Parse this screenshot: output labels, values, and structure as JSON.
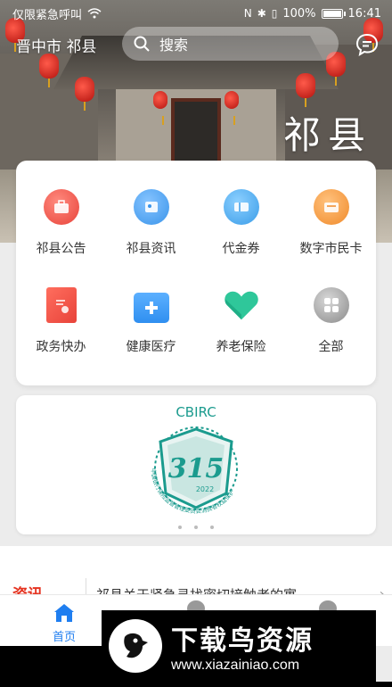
{
  "status_bar": {
    "carrier": "仅限紧急呼叫",
    "battery": "100%",
    "time": "16:41"
  },
  "header": {
    "city": "晋中市 祁县",
    "search_placeholder": "搜索",
    "calligraphy": "祁县"
  },
  "services": [
    {
      "label": "祁县公告",
      "icon": "notice-icon",
      "color": "#e8433a"
    },
    {
      "label": "祁县资讯",
      "icon": "news-icon",
      "color": "#3a94ea"
    },
    {
      "label": "代金券",
      "icon": "voucher-icon",
      "color": "#3a9ce8"
    },
    {
      "label": "数字市民卡",
      "icon": "citizen-card-icon",
      "color": "#f08a2a"
    },
    {
      "label": "政务快办",
      "icon": "government-affairs-icon",
      "color": "#e8433a"
    },
    {
      "label": "健康医疗",
      "icon": "medical-icon",
      "color": "#2f8ff0"
    },
    {
      "label": "养老保险",
      "icon": "heart-icon",
      "color": "#2fc79a"
    },
    {
      "label": "全部",
      "icon": "all-icon",
      "color": "#9a9a9a"
    }
  ],
  "banner": {
    "logo_top": "CBIRC",
    "logo_number": "315",
    "logo_year": "2022",
    "logo_ring_text": "中国银行保险监督管理委员会消费者权益保护"
  },
  "news": {
    "tag": "资讯",
    "headline": "祁县关于紧急寻找密切接触者的寓"
  },
  "tabbar": {
    "home_label": "首页"
  },
  "watermark": {
    "title": "下载鸟资源",
    "url": "www.xiazainiao.com"
  },
  "colors": {
    "accent": "#1f7ef0",
    "news_red": "#e5321f"
  }
}
